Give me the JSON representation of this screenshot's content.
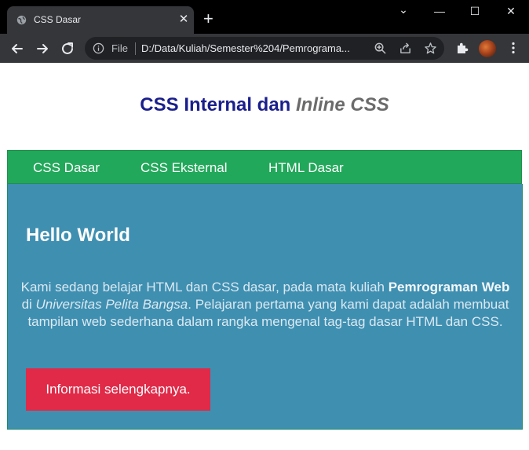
{
  "browser": {
    "tab_title": "CSS Dasar",
    "close_glyph": "✕",
    "new_tab_glyph": "+",
    "site_label": "File",
    "url": "D:/Data/Kuliah/Semester%204/Pemrograma...",
    "window_controls": {
      "minimize": "—",
      "maximize": "☐",
      "close": "✕",
      "tab_search": "⌄"
    }
  },
  "page": {
    "title_plain": "CSS Internal dan",
    "title_italic": "Inline CSS",
    "nav": [
      {
        "label": "CSS Dasar"
      },
      {
        "label": "CSS Eksternal"
      },
      {
        "label": "HTML Dasar"
      }
    ],
    "heading": "Hello World",
    "paragraph": {
      "text1": "Kami sedang belajar HTML dan CSS dasar, pada mata kuliah ",
      "bold": "Pemrograman Web",
      "text2": " di ",
      "italic": "Universitas Pelita Bangsa",
      "text3": ". Pelajaran pertama yang kami dapat adalah membuat tampilan web sederhana dalam rangka mengenal tag-tag dasar HTML dan CSS."
    },
    "button_label": "Informasi selengkapnya."
  },
  "colors": {
    "title": "#1a1f8c",
    "title_italic": "#6b6b6b",
    "navbar": "#22a85a",
    "content_bg": "#3f8fb1",
    "button": "#e02a48"
  }
}
